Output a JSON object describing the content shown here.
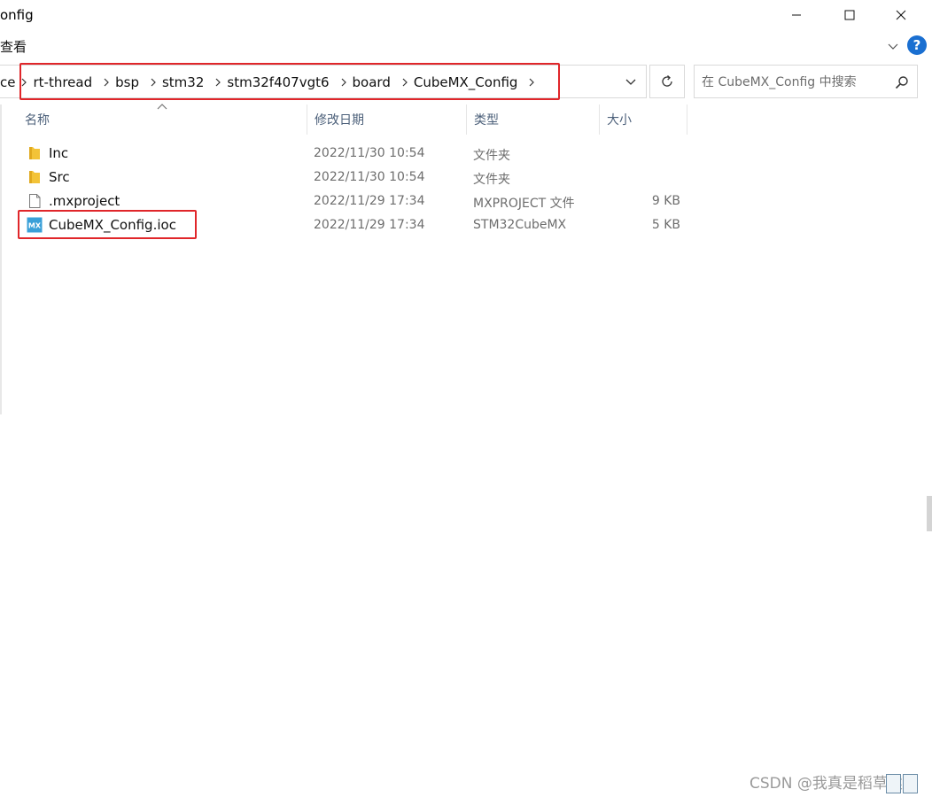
{
  "window": {
    "title_partial": "onfig",
    "minimize_glyph": "—",
    "maximize_glyph": "☐",
    "close_glyph": "✕"
  },
  "ribbon": {
    "tab_view": "查看",
    "help_glyph": "?"
  },
  "address": {
    "crumbs": [
      "ce",
      "rt-thread",
      "bsp",
      "stm32",
      "stm32f407vgt6",
      "board",
      "CubeMX_Config"
    ]
  },
  "search": {
    "placeholder": "在 CubeMX_Config 中搜索"
  },
  "columns": {
    "name": "名称",
    "date": "修改日期",
    "type": "类型",
    "size": "大小"
  },
  "files": [
    {
      "name": "Inc",
      "date": "2022/11/30 10:54",
      "type": "文件夹",
      "size": "",
      "icon": "folder-icon"
    },
    {
      "name": "Src",
      "date": "2022/11/30 10:54",
      "type": "文件夹",
      "size": "",
      "icon": "folder-icon"
    },
    {
      "name": ".mxproject",
      "date": "2022/11/29 17:34",
      "type": "MXPROJECT 文件",
      "size": "9 KB",
      "icon": "blank-file-icon"
    },
    {
      "name": "CubeMX_Config.ioc",
      "date": "2022/11/29 17:34",
      "type": "STM32CubeMX",
      "size": "5 KB",
      "icon": "cubemx-file-icon"
    }
  ],
  "cubemx_icon_label": "MX",
  "watermark": "CSDN @我真是稻草猿",
  "colors": {
    "highlight": "#e0262a",
    "folder": "#f3c338",
    "cubemx": "#3aa0d8",
    "help": "#1a6fd1"
  }
}
